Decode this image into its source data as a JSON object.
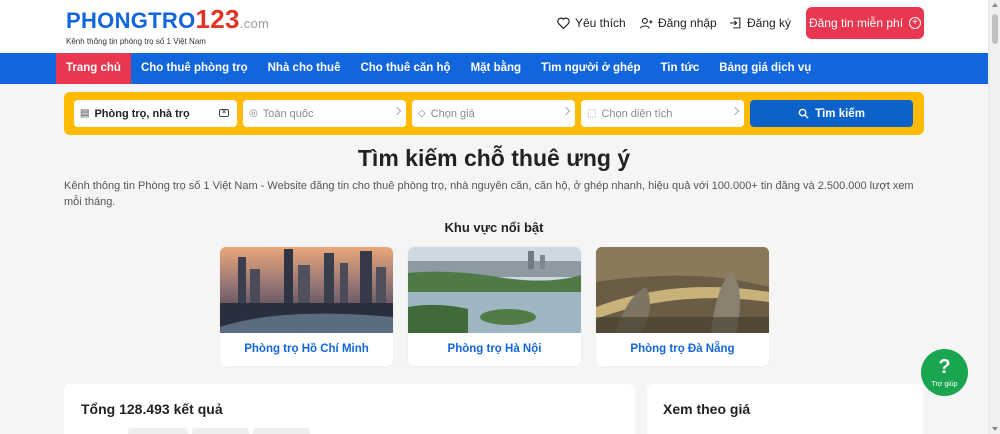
{
  "logo": {
    "part1": "PHONGTRO",
    "part2": "123",
    "part3": ".com",
    "tagline": "Kênh thông tin phòng trọ số 1 Việt Nam"
  },
  "header": {
    "favorite": "Yêu thích",
    "login": "Đăng nhập",
    "register": "Đăng ký",
    "post": "Đăng tin miễn phí"
  },
  "nav": {
    "items": [
      "Trang chủ",
      "Cho thuê phòng trọ",
      "Nhà cho thuê",
      "Cho thuê căn hộ",
      "Mặt bằng",
      "Tìm người ở ghép",
      "Tin tức",
      "Bảng giá dịch vụ"
    ]
  },
  "search": {
    "category": "Phòng trọ, nhà trọ",
    "location": "Toàn quốc",
    "price": "Chọn giá",
    "area": "Chọn diện tích",
    "button": "Tìm kiếm"
  },
  "main": {
    "title": "Tìm kiếm chỗ thuê ưng ý",
    "description": "Kênh thông tin Phòng trọ số 1 Việt Nam - Website đăng tin cho thuê phòng trọ, nhà nguyên căn, căn hộ, ở ghép nhanh, hiệu quả với 100.000+ tin đăng và 2.500.000 lượt xem mỗi tháng.",
    "section_title": "Khu vực nổi bật",
    "regions": [
      "Phòng trọ Hồ Chí Minh",
      "Phòng trọ Hà Nội",
      "Phòng trọ Đà Nẵng"
    ],
    "result_count": "Tổng 128.493 kết quả",
    "price_filter_title": "Xem theo giá"
  },
  "help": {
    "symbol": "?",
    "label": "Trợ giúp"
  },
  "colors": {
    "brand_blue": "#1266dd",
    "brand_red": "#e8374f",
    "search_yellow": "#febb02",
    "help_green": "#1aa551"
  }
}
